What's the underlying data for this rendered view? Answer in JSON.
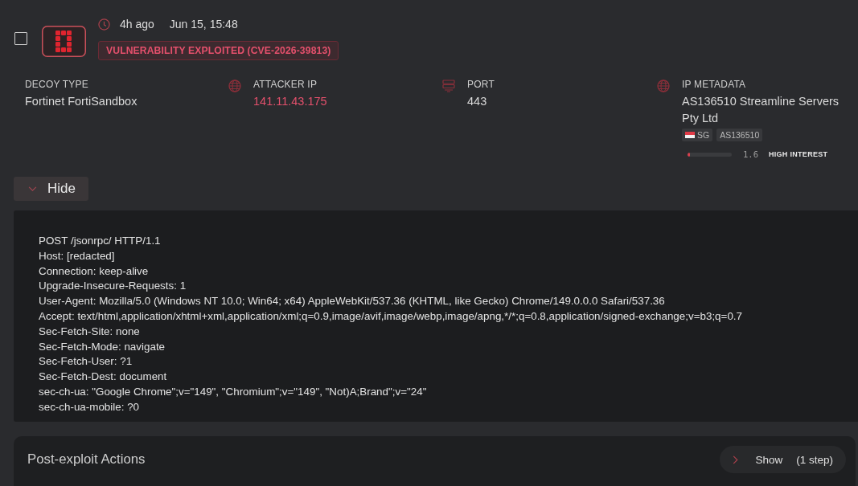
{
  "event": {
    "checked": false,
    "time_ago": "4h ago",
    "timestamp": "Jun 15, 15:48",
    "badge": "VULNERABILITY EXPLOITED (CVE-2026-39813)"
  },
  "fields": [
    {
      "kind": "plain",
      "label": "DECOY TYPE",
      "value": "Fortinet FortiSandbox"
    },
    {
      "kind": "ip",
      "label": "ATTACKER IP",
      "value": "141.11.43.175"
    },
    {
      "kind": "port",
      "label": "PORT",
      "value": "443"
    },
    {
      "kind": "metadata",
      "label": "IP METADATA",
      "value": "AS136510 Streamline Servers Pty Ltd",
      "country": "SG",
      "asn": "AS136510",
      "interest": {
        "level": 0.05,
        "score": "1.6",
        "label": "HIGH INTEREST"
      }
    }
  ],
  "request": {
    "expanded": true,
    "toggle_label": "Hide",
    "lines": [
      "POST /jsonrpc/ HTTP/1.1",
      "Host: [redacted]",
      "Connection: keep-alive",
      "Upgrade-Insecure-Requests: 1",
      "User-Agent: Mozilla/5.0 (Windows NT 10.0; Win64; x64) AppleWebKit/537.36 (KHTML, like Gecko) Chrome/149.0.0.0 Safari/537.36",
      "Accept: text/html,application/xhtml+xml,application/xml;q=0.9,image/avif,image/webp,image/apng,*/*;q=0.8,application/signed-exchange;v=b3;q=0.7",
      "Sec-Fetch-Site: none",
      "Sec-Fetch-Mode: navigate",
      "Sec-Fetch-User: ?1",
      "Sec-Fetch-Dest: document",
      "sec-ch-ua: \"Google Chrome\";v=\"149\", \"Chromium\";v=\"149\", \"Not)A;Brand\";v=\"24\"",
      "sec-ch-ua-mobile: ?0"
    ]
  },
  "post_exploit": {
    "title": "Post-exploit Actions",
    "expanded": false,
    "toggle_label": "Show",
    "count": "(1 step)"
  }
}
